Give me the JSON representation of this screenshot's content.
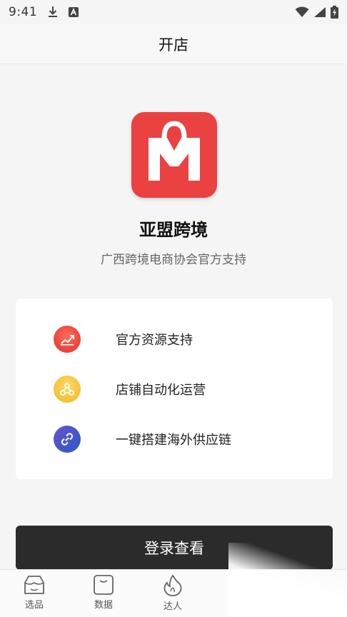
{
  "status_bar": {
    "time": "9:41",
    "icons": [
      "download-icon",
      "a-badge-icon",
      "wifi-icon",
      "signal-icon",
      "battery-icon"
    ]
  },
  "nav": {
    "title": "开店"
  },
  "brand": {
    "name": "亚盟跨境",
    "subtitle": "广西跨境电商协会官方支持",
    "logo_color": "#ea4141"
  },
  "features": [
    {
      "label": "官方资源支持",
      "icon": "chart-growth-icon",
      "color": "#e1322a"
    },
    {
      "label": "店铺自动化运营",
      "icon": "nodes-icon",
      "color": "#f0b820"
    },
    {
      "label": "一键搭建海外供应链",
      "icon": "link-icon",
      "color": "#2a5bc9"
    }
  ],
  "login_button": {
    "label": "登录查看"
  },
  "tabs": [
    {
      "label": "选品",
      "icon": "shop-icon"
    },
    {
      "label": "数据",
      "icon": "bag-icon"
    },
    {
      "label": "达人",
      "icon": "flame-icon"
    }
  ]
}
